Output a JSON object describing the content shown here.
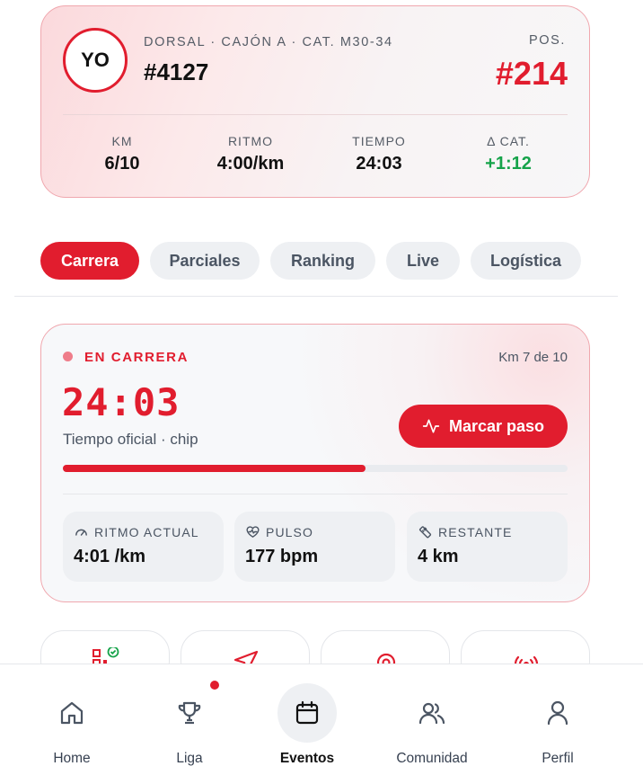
{
  "racer": {
    "avatar": "YO",
    "meta": "DORSAL · CAJÓN A · CAT. M30-34",
    "bib": "#4127",
    "pos_label": "POS.",
    "pos_value": "#214",
    "stats": [
      {
        "label": "KM",
        "value": "6/10"
      },
      {
        "label": "RITMO",
        "value": "4:00/km"
      },
      {
        "label": "TIEMPO",
        "value": "24:03"
      },
      {
        "label": "Δ CAT.",
        "value": "+1:12"
      }
    ]
  },
  "tabs": [
    {
      "label": "Carrera",
      "active": true
    },
    {
      "label": "Parciales"
    },
    {
      "label": "Ranking"
    },
    {
      "label": "Live"
    },
    {
      "label": "Logística"
    }
  ],
  "race": {
    "status": "EN CARRERA",
    "km_progress": "Km 7 de 10",
    "timer": "24:03",
    "timer_caption": "Tiempo oficial · chip",
    "pace_button": "Marcar paso",
    "progress_fraction": 0.6,
    "metrics": [
      {
        "label": "RITMO ACTUAL",
        "value": "4:01 /km",
        "icon": "gauge-icon"
      },
      {
        "label": "PULSO",
        "value": "177 bpm",
        "icon": "heart-pulse-icon"
      },
      {
        "label": "RESTANTE",
        "value": "4 km",
        "icon": "ruler-icon"
      }
    ]
  },
  "quick_actions": [
    {
      "icon": "qr-check-icon"
    },
    {
      "icon": "send-icon"
    },
    {
      "icon": "target-icon"
    },
    {
      "icon": "broadcast-icon"
    }
  ],
  "nav": [
    {
      "label": "Home",
      "icon": "home-icon"
    },
    {
      "label": "Liga",
      "icon": "trophy-icon",
      "badge": true
    },
    {
      "label": "Eventos",
      "icon": "calendar-icon",
      "active": true
    },
    {
      "label": "Comunidad",
      "icon": "users-icon"
    },
    {
      "label": "Perfil",
      "icon": "user-icon"
    }
  ],
  "colors": {
    "accent": "#e11d2e",
    "positive": "#16a34a",
    "muted_bg": "#eef0f3"
  }
}
